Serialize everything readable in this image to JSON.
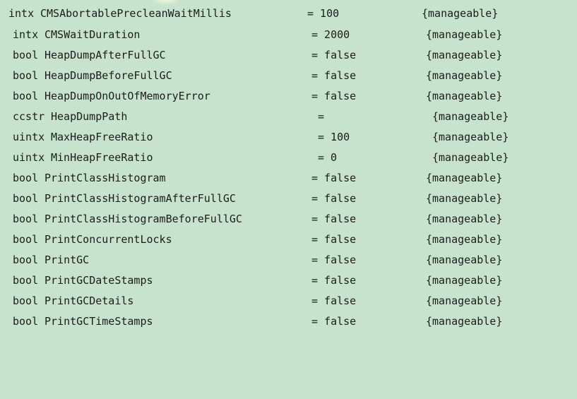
{
  "flags": [
    {
      "type": "intx",
      "name": "CMSAbortablePrecleanWaitMillis",
      "value": "= 100",
      "attr": "{manageable}"
    },
    {
      "type": "intx",
      "name": "CMSWaitDuration",
      "value": "= 2000",
      "attr": "{manageable}"
    },
    {
      "type": "bool",
      "name": "HeapDumpAfterFullGC",
      "value": "= false",
      "attr": "{manageable}"
    },
    {
      "type": "bool",
      "name": "HeapDumpBeforeFullGC",
      "value": "= false",
      "attr": "{manageable}"
    },
    {
      "type": "bool",
      "name": "HeapDumpOnOutOfMemoryError",
      "value": "= false",
      "attr": "{manageable}"
    },
    {
      "type": "ccstr",
      "name": "HeapDumpPath",
      "value": "=",
      "attr": "{manageable}"
    },
    {
      "type": "uintx",
      "name": "MaxHeapFreeRatio",
      "value": "= 100",
      "attr": "{manageable}"
    },
    {
      "type": "uintx",
      "name": "MinHeapFreeRatio",
      "value": "= 0",
      "attr": "{manageable}"
    },
    {
      "type": "bool",
      "name": "PrintClassHistogram",
      "value": "= false",
      "attr": "{manageable}"
    },
    {
      "type": "bool",
      "name": "PrintClassHistogramAfterFullGC",
      "value": "= false",
      "attr": "{manageable}"
    },
    {
      "type": "bool",
      "name": "PrintClassHistogramBeforeFullGC",
      "value": "= false",
      "attr": "{manageable}"
    },
    {
      "type": "bool",
      "name": "PrintConcurrentLocks",
      "value": "= false",
      "attr": "{manageable}"
    },
    {
      "type": "bool",
      "name": "PrintGC",
      "value": "= false",
      "attr": "{manageable}"
    },
    {
      "type": "bool",
      "name": "PrintGCDateStamps",
      "value": "= false",
      "attr": "{manageable}"
    },
    {
      "type": "bool",
      "name": "PrintGCDetails",
      "value": "= false",
      "attr": "{manageable}"
    },
    {
      "type": "bool",
      "name": "PrintGCTimeStamps",
      "value": "= false",
      "attr": "{manageable}"
    }
  ]
}
